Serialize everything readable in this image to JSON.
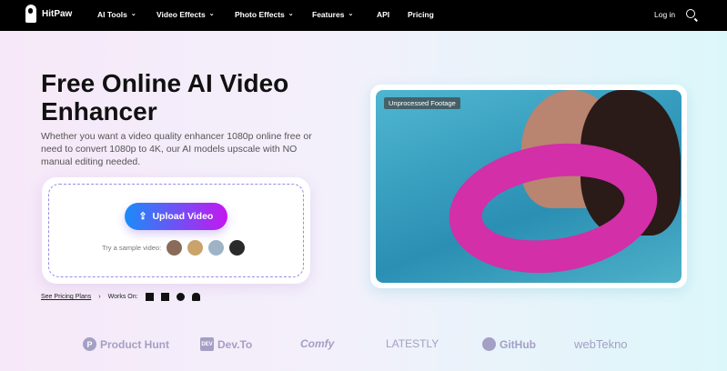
{
  "nav": {
    "brand": "HitPaw",
    "items": [
      {
        "label": "AI Tools",
        "dropdown": true
      },
      {
        "label": "Video Effects",
        "dropdown": true
      },
      {
        "label": "Photo Effects",
        "dropdown": true
      },
      {
        "label": "Features",
        "dropdown": true
      },
      {
        "label": "API",
        "dropdown": false
      },
      {
        "label": "Pricing",
        "dropdown": false
      }
    ],
    "login": "Log in"
  },
  "hero": {
    "title": "Free Online AI Video Enhancer",
    "description": "Whether you want a video quality enhancer 1080p online free or need to convert 1080p to 4K, our AI models upscale with NO manual editing needed.",
    "upload_label": "Upload Video",
    "sample_label": "Try a sample video:",
    "pricing_link": "See Pricing Plans",
    "works_on": "Works On:",
    "platforms": [
      "windows",
      "mac",
      "app-store",
      "android"
    ]
  },
  "preview": {
    "tag": "Unprocessed Footage"
  },
  "brands": [
    "Product Hunt",
    "Dev.To",
    "Comfy",
    "LATESTLY",
    "GitHub",
    "webTekno"
  ],
  "colors": {
    "accent_start": "#1a8cf8",
    "accent_end": "#c417f0"
  }
}
